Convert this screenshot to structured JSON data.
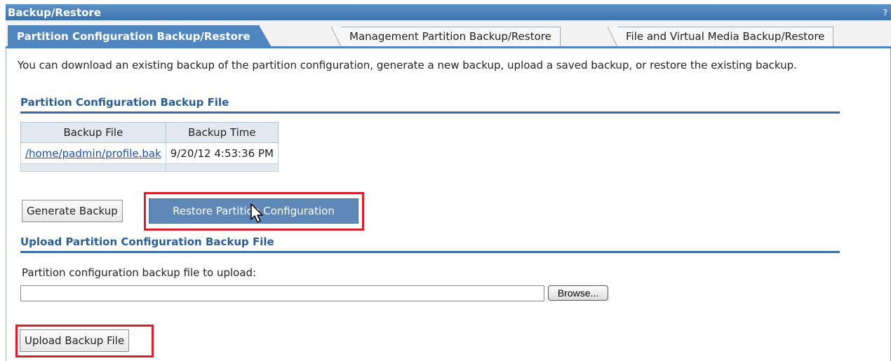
{
  "panel": {
    "title": "Backup/Restore",
    "help_icon": "?"
  },
  "tabs": [
    {
      "label": "Partition Configuration Backup/Restore",
      "active": true
    },
    {
      "label": "Management Partition Backup/Restore",
      "active": false
    },
    {
      "label": "File and Virtual Media Backup/Restore",
      "active": false
    }
  ],
  "intro_text": "You can download an existing backup of the partition configuration, generate a new backup, upload a saved backup, or restore the existing backup.",
  "backup_section": {
    "heading": "Partition Configuration Backup File",
    "columns": [
      "Backup File",
      "Backup Time"
    ],
    "rows": [
      {
        "file": "/home/padmin/profile.bak",
        "time": "9/20/12 4:53:36 PM"
      }
    ],
    "generate_button": "Generate Backup",
    "restore_button": "Restore Partition Configuration"
  },
  "upload_section": {
    "heading": "Upload Partition Configuration Backup File",
    "field_label": "Partition configuration backup file to upload:",
    "file_value": "",
    "browse_button": "Browse...",
    "upload_button": "Upload Backup File"
  },
  "colors": {
    "accent": "#4f86c0",
    "heading": "#2b5f94",
    "highlight": "#d8202a"
  }
}
